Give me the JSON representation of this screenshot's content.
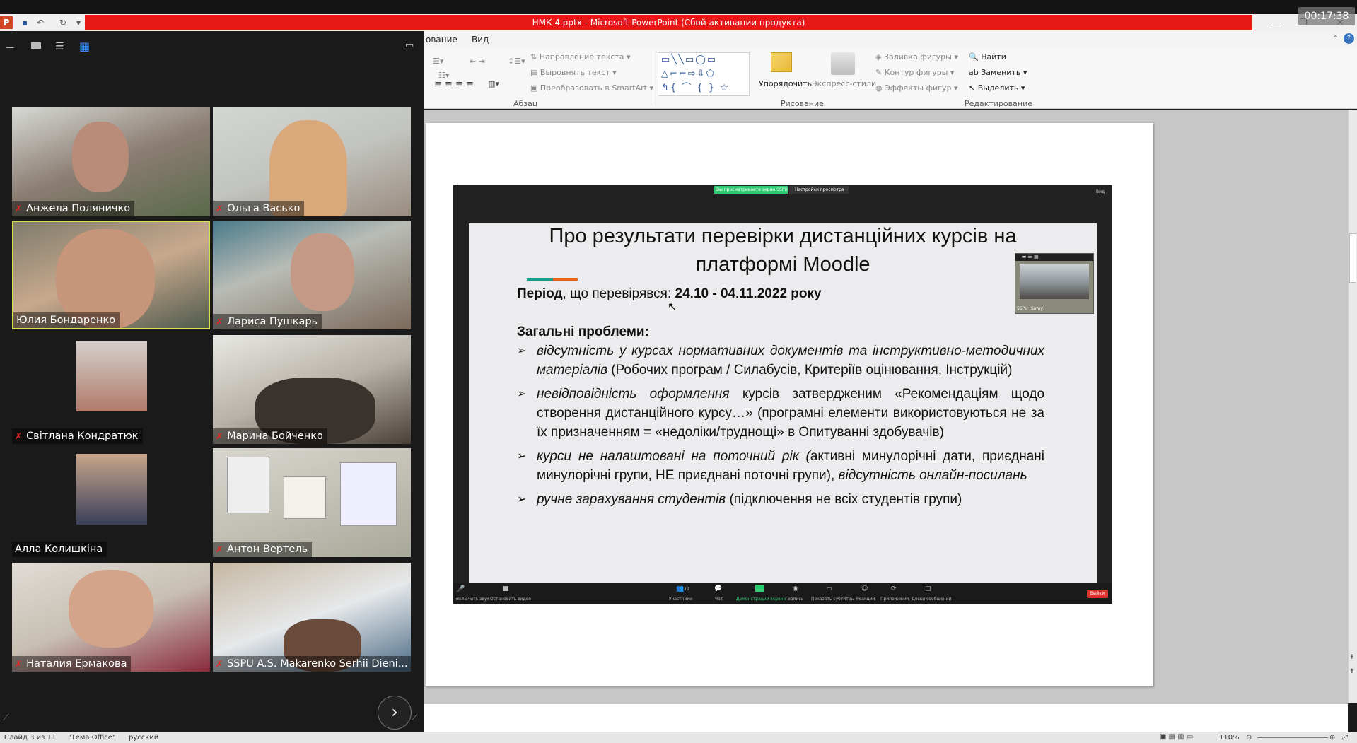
{
  "window": {
    "title": "НМК 4.pptx - Microsoft PowerPoint (Сбой активации продукта)",
    "timer": "00:17:38"
  },
  "menu": {
    "items": [
      "ование",
      "Вид"
    ]
  },
  "ribbon": {
    "paragraph": {
      "group_label": "Абзац",
      "text_direction": "Направление текста",
      "align_text": "Выровнять текст",
      "convert_smartart": "Преобразовать в SmartArt"
    },
    "drawing": {
      "group_label": "Рисование",
      "arrange": "Упорядочить",
      "quick_styles": "Экспресс-стили",
      "shape_fill": "Заливка фигуры",
      "shape_outline": "Контур фигуры",
      "shape_effects": "Эффекты фигур"
    },
    "editing": {
      "group_label": "Редактирование",
      "find": "Найти",
      "replace": "Заменить",
      "select": "Выделить"
    }
  },
  "share_banner": {
    "viewing": "Вы просматриваете экран SSPU",
    "view_options": "Настройки просмотра",
    "view_btn": "Вид",
    "thumb_label": "SSPU (Sumy)"
  },
  "slide": {
    "title_line1": "Про результати перевірки дистанційних курсів на",
    "title_line2": "платформі Moodle",
    "period_label": "Період",
    "period_text": ", що перевірявся: ",
    "period_value": "24.10 - 04.11.2022 року",
    "problems_heading": "Загальні проблеми:",
    "bullets": [
      {
        "italic": "відсутність у курсах нормативних документів та інструктивно-методичних матеріалів",
        "normal": " (Робочих програм / Силабусів, Критеріїв оцінювання, Інструкцій)"
      },
      {
        "italic": "невідповідність оформлення",
        "normal": " курсів затвердженим «Рекомендаціям щодо створення дистанційного курсу…» (програмні елементи використовуються не за їх призначенням = «недоліки/труднощі» в Опитуванні здобувачів)"
      },
      {
        "italic": "курси не налаштовані на поточний рік (",
        "normal": "активні минулорічні дати, приєднані минулорічні групи, НЕ приєднані поточні групи),",
        "italic2": " відсутність онлайн-посилань"
      },
      {
        "italic": "ручне зарахування студентів",
        "normal": " (підключення не всіх студентів групи)"
      }
    ]
  },
  "zoom_toolbar": {
    "mute": "Включить звук",
    "stop_video": "Остановить видео",
    "participants": "Участники",
    "participants_count": "19",
    "chat": "Чат",
    "share": "Демонстрация экрана",
    "record": "Запись",
    "subtitles": "Показать субтитры",
    "reactions": "Реакции",
    "apps": "Приложения",
    "whiteboards": "Доски сообщений",
    "leave": "Выйти"
  },
  "participants": [
    {
      "name": "Анжела Поляничко",
      "muted": true
    },
    {
      "name": "Ольга Васько",
      "muted": true
    },
    {
      "name": "Юлия Бондаренко",
      "muted": false,
      "active": true
    },
    {
      "name": "Лариса Пушкарь",
      "muted": true
    },
    {
      "name": "Світлана Кондратюк",
      "muted": true
    },
    {
      "name": "Марина Бойченко",
      "muted": true
    },
    {
      "name": "Алла Колишкіна",
      "muted": false
    },
    {
      "name": "Антон Вертель",
      "muted": true
    },
    {
      "name": "Наталия Ермакова",
      "muted": true
    },
    {
      "name": "SSPU A.S. Makarenko Serhii Dieni...",
      "muted": true
    }
  ],
  "statusbar": {
    "slide": "Слайд 3 из 11",
    "theme": "\"Тема Office\"",
    "lang": "русский",
    "zoom": "110%"
  },
  "colors": {
    "title_red": "#e81818",
    "speaker_border": "#d7e34a",
    "mute_red": "#e02020",
    "share_green": "#2ecc71",
    "leave_red": "#e03030"
  }
}
